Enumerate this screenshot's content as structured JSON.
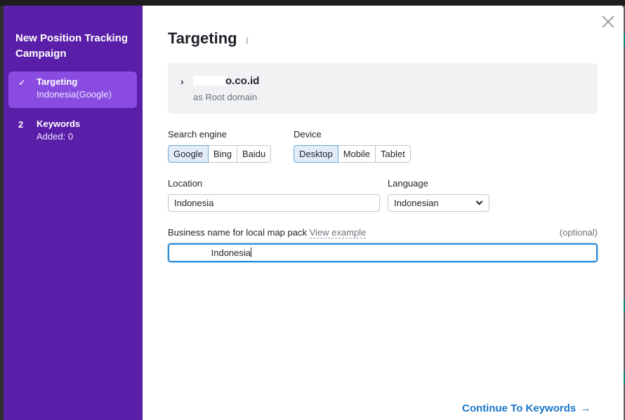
{
  "sidebar": {
    "title": "New Position Tracking Campaign",
    "steps": [
      {
        "marker": "✓",
        "title": "Targeting",
        "subtitle": "Indonesia(Google)"
      },
      {
        "marker": "2",
        "title": "Keywords",
        "subtitle": "Added: 0"
      }
    ]
  },
  "main": {
    "title": "Targeting",
    "info_icon": "i",
    "domain": {
      "name_suffix": ".co.id",
      "name_prefix_partial": "o",
      "type": "as Root domain"
    },
    "search_engine": {
      "label": "Search engine",
      "options": [
        "Google",
        "Bing",
        "Baidu"
      ],
      "selected": "Google"
    },
    "device": {
      "label": "Device",
      "options": [
        "Desktop",
        "Mobile",
        "Tablet"
      ],
      "selected": "Desktop"
    },
    "location": {
      "label": "Location",
      "value": "Indonesia"
    },
    "language": {
      "label": "Language",
      "value": "Indonesian"
    },
    "business": {
      "label": "Business name for local map pack",
      "link": "View example",
      "optional": "(optional)",
      "value": "Indonesia"
    },
    "continue_label": "Continue To Keywords",
    "continue_arrow": "→"
  },
  "icons": {
    "close": "close-icon",
    "chevron": "chevron-right-icon",
    "info": "info-icon",
    "check": "check-icon",
    "caret": "chevron-down-icon",
    "arrow": "arrow-right-icon"
  },
  "colors": {
    "sidebar": "#5a1fa8",
    "active_step": "#8a4ce0",
    "accent": "#1b75c9",
    "selected_option": "#e2ecf7"
  }
}
